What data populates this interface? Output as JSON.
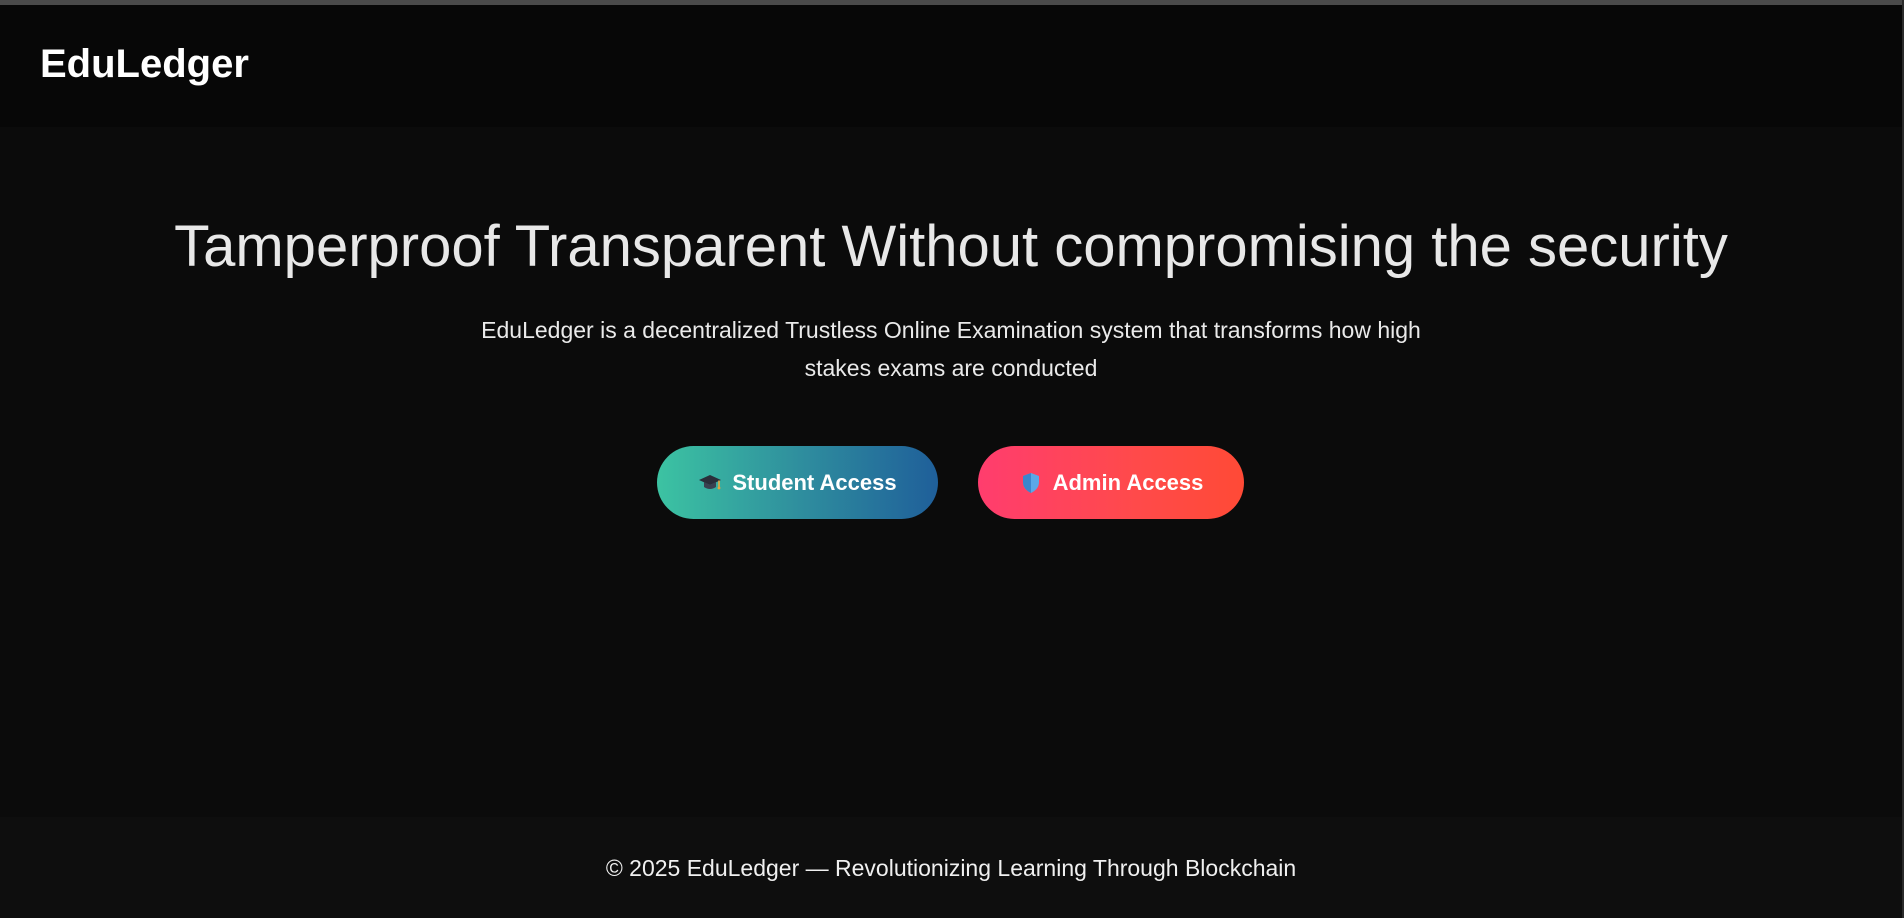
{
  "header": {
    "logo": "EduLedger"
  },
  "hero": {
    "title": "Tamperproof Transparent Without compromising the security",
    "description": "EduLedger is a decentralized Trustless Online Examination system that transforms how high stakes exams are conducted"
  },
  "buttons": {
    "student": {
      "label": "Student Access",
      "icon": "graduation-cap-icon"
    },
    "admin": {
      "label": "Admin Access",
      "icon": "shield-icon"
    }
  },
  "footer": {
    "text": "© 2025 EduLedger — Revolutionizing Learning Through Blockchain"
  },
  "colors": {
    "background": "#0b0b0b",
    "student_gradient_start": "#3cc3a2",
    "student_gradient_end": "#1f5f9a",
    "admin_gradient_start": "#ff3d6e",
    "admin_gradient_end": "#ff4a36"
  }
}
